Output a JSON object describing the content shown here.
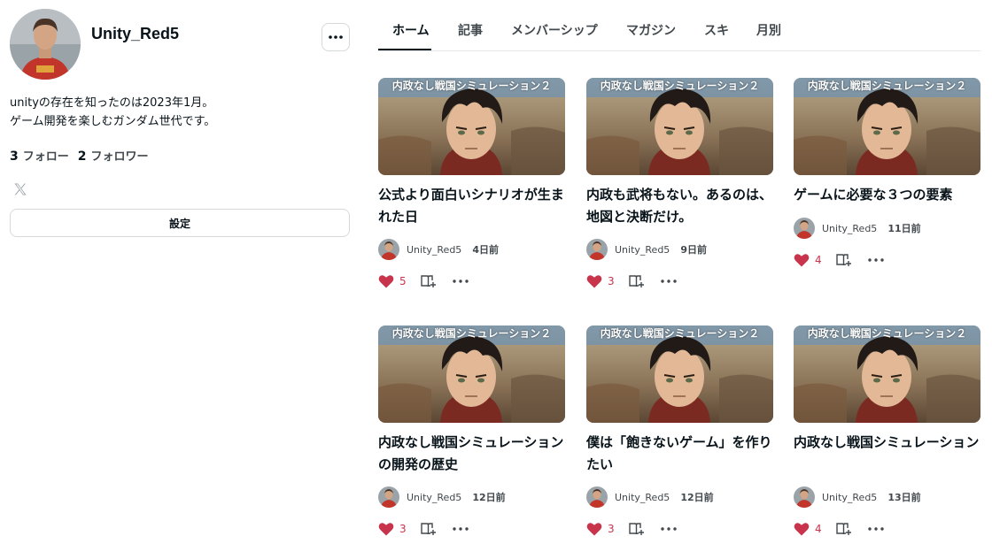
{
  "profile": {
    "username": "Unity_Red5",
    "bio": [
      "unityの存在を知ったのは2023年1月。",
      "ゲーム開発を楽しむガンダム世代です。"
    ],
    "follow_count": "3",
    "follow_label": "フォロー",
    "follower_count": "2",
    "follower_label": "フォロワー",
    "social_icon": "x-logo-icon",
    "settings_label": "設定",
    "more_icon": "more-horizontal-icon"
  },
  "tabs": [
    {
      "label": "ホーム",
      "active": true
    },
    {
      "label": "記事",
      "active": false
    },
    {
      "label": "メンバーシップ",
      "active": false
    },
    {
      "label": "マガジン",
      "active": false
    },
    {
      "label": "スキ",
      "active": false
    },
    {
      "label": "月別",
      "active": false
    }
  ],
  "articles": [
    {
      "thumb_caption": "内政なし戦国シミュレーション２",
      "title": "公式より面白いシナリオが生まれた日",
      "author": "Unity_Red5",
      "date": "4日前",
      "likes": "5"
    },
    {
      "thumb_caption": "内政なし戦国シミュレーション２",
      "title": "内政も武将もない。あるのは、地図と決断だけ。",
      "author": "Unity_Red5",
      "date": "9日前",
      "likes": "3"
    },
    {
      "thumb_caption": "内政なし戦国シミュレーション２",
      "title": "ゲームに必要な３つの要素",
      "author": "Unity_Red5",
      "date": "11日前",
      "likes": "4"
    },
    {
      "thumb_caption": "内政なし戦国シミュレーション２",
      "title": "内政なし戦国シミュレーションの開発の歴史",
      "author": "Unity_Red5",
      "date": "12日前",
      "likes": "3"
    },
    {
      "thumb_caption": "内政なし戦国シミュレーション２",
      "title": "僕は「飽きないゲーム」を作りたい",
      "author": "Unity_Red5",
      "date": "12日前",
      "likes": "3"
    },
    {
      "thumb_caption": "内政なし戦国シミュレーション２",
      "title": "内政なし戦国シミュレーション",
      "author": "Unity_Red5",
      "date": "13日前",
      "likes": "4"
    }
  ],
  "colors": {
    "like": "#c8344c",
    "text": "#08131a",
    "muted": "#41484d",
    "border": "#d6d9db"
  }
}
